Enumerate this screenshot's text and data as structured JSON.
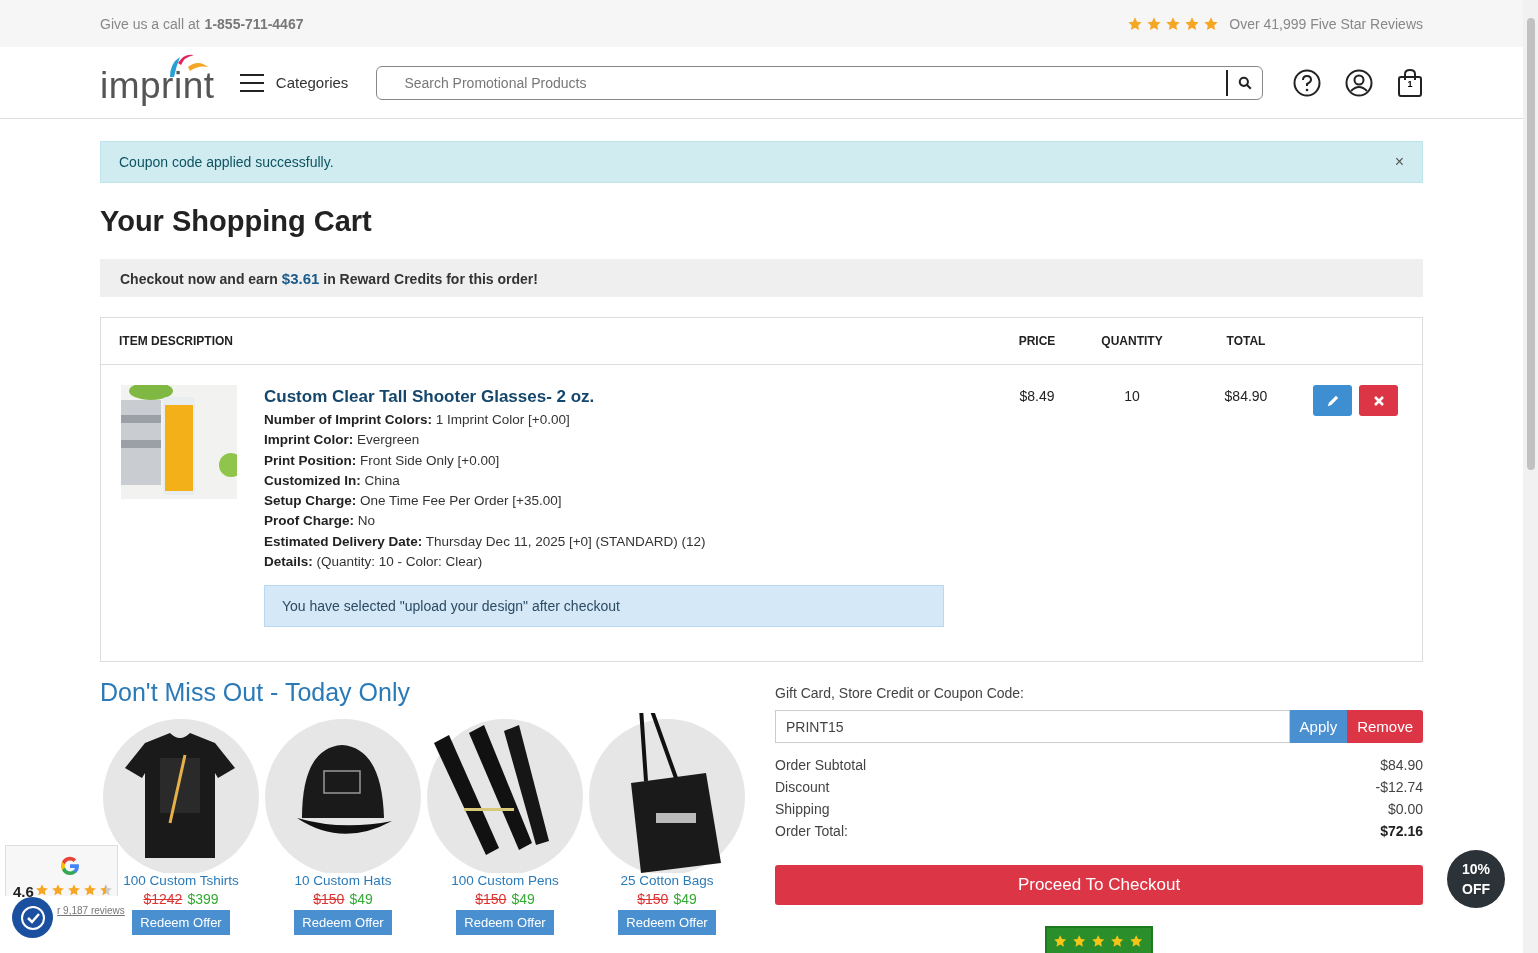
{
  "top_bar": {
    "call_label": "Give us a call at",
    "phone": "1-855-711-4467",
    "stars": 5,
    "reviews": "Over 41,999 Five Star Reviews"
  },
  "header": {
    "logo": "imprint",
    "categories": "Categories",
    "search_placeholder": "Search Promotional Products",
    "cart_count": "1"
  },
  "alert": {
    "message": "Coupon code applied successfully.",
    "close": "×"
  },
  "title": "Your Shopping Cart",
  "reward": "Checkout now and earn **$3.61** in Reward Credits for this order!",
  "table": {
    "columns": [
      "ITEM DESCRIPTION",
      "PRICE",
      "QUANTITY",
      "TOTAL"
    ],
    "rows": [
      {
        "name": "Custom Clear Tall Shooter Glasses- 2 oz.",
        "details": [
          {
            "label": "Number of Imprint Colors:",
            "value": "1 Imprint Color [+0.00]"
          },
          {
            "label": "Imprint Color:",
            "value": "Evergreen"
          },
          {
            "label": "Print Position:",
            "value": "Front Side Only [+0.00]"
          },
          {
            "label": "Customized In:",
            "value": "China"
          },
          {
            "label": "Setup Charge:",
            "value": "One Time Fee Per Order [+35.00]"
          },
          {
            "label": "Proof Charge:",
            "value": "No"
          },
          {
            "label": "Estimated Delivery Date:",
            "value": "Thursday Dec 11, 2025 [+0] (STANDARD) (12)"
          },
          {
            "label": "Details:",
            "value": "(Quantity: 10 - Color: Clear)"
          }
        ],
        "note": "You have selected \"upload your design\" after checkout",
        "price": "$8.49",
        "quantity": "10",
        "total": "$84.90"
      }
    ]
  },
  "promo": {
    "title": "Don't Miss Out - Today Only",
    "items": [
      {
        "kind": "tshirt",
        "name": "100 Custom Tshirts",
        "old_price": "$1242",
        "price": "$399",
        "button": "Redeem Offer"
      },
      {
        "kind": "hat",
        "name": "10 Custom Hats",
        "old_price": "$150",
        "price": "$49",
        "button": "Redeem Offer"
      },
      {
        "kind": "pens",
        "name": "100 Custom Pens",
        "old_price": "$150",
        "price": "$49",
        "button": "Redeem Offer"
      },
      {
        "kind": "bag",
        "name": "25 Cotton Bags",
        "old_price": "$150",
        "price": "$49",
        "button": "Redeem Offer"
      }
    ]
  },
  "coupon": {
    "label": "Gift Card, Store Credit or Coupon Code:",
    "value": "PRINT15",
    "apply": "Apply",
    "remove": "Remove"
  },
  "summary": [
    {
      "label": "Order Subtotal",
      "value": "$84.90",
      "bold": false
    },
    {
      "label": "Discount",
      "value": "-$12.74",
      "bold": false
    },
    {
      "label": "Shipping",
      "value": "$0.00",
      "bold": false
    },
    {
      "label": "Order Total:",
      "value": "$72.16",
      "bold": true
    }
  ],
  "checkout": "Proceed To Checkout",
  "google_widget": {
    "rating": "4.6",
    "stars": 4.5,
    "reviews": "r 9,187 reviews"
  },
  "discount_badge": {
    "line1": "10%",
    "line2": "OFF"
  }
}
